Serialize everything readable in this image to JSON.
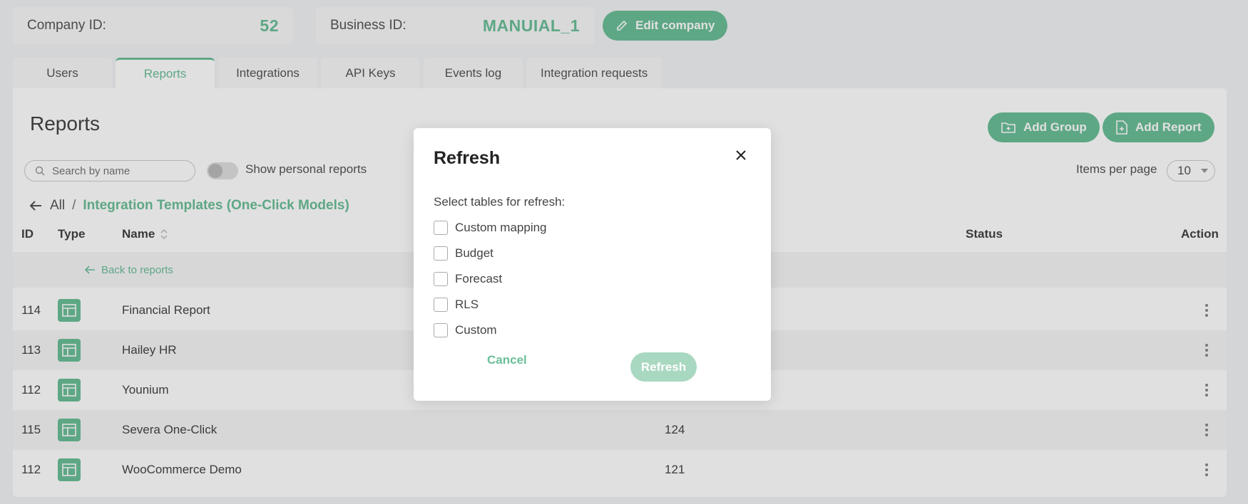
{
  "topbar": {
    "company_label": "Company ID:",
    "company_value": "52",
    "business_label": "Business ID:",
    "business_value": "MANUIAL_1",
    "edit_label": "Edit company"
  },
  "tabs": [
    {
      "label": "Users"
    },
    {
      "label": "Reports",
      "active": true
    },
    {
      "label": "Integrations"
    },
    {
      "label": "API Keys"
    },
    {
      "label": "Events log"
    },
    {
      "label": "Integration requests"
    }
  ],
  "panel": {
    "title": "Reports",
    "add_group": "Add Group",
    "add_report": "Add Report",
    "search_placeholder": "Search by name",
    "toggle_label": "Show personal reports",
    "ipp_label": "Items per page",
    "ipp_value": "10"
  },
  "breadcrumb": {
    "all": "All",
    "sep": "/",
    "current": "Integration Templates (One-Click Models)"
  },
  "table": {
    "headers": {
      "id": "ID",
      "type": "Type",
      "name": "Name",
      "status": "Status",
      "action": "Action"
    },
    "back_label": "Back to reports",
    "rows": [
      {
        "id": "114",
        "name": "Financial Report",
        "extra": ""
      },
      {
        "id": "113",
        "name": "Hailey HR",
        "extra": ""
      },
      {
        "id": "112",
        "name": "Younium",
        "extra": ""
      },
      {
        "id": "115",
        "name": "Severa One-Click",
        "extra": "124"
      },
      {
        "id": "112",
        "name": "WooCommerce Demo",
        "extra": "121"
      }
    ]
  },
  "modal": {
    "title": "Refresh",
    "subtitle": "Select tables for refresh:",
    "options": [
      "Custom mapping",
      "Budget",
      "Forecast",
      "RLS",
      "Custom"
    ],
    "cancel": "Cancel",
    "refresh": "Refresh"
  },
  "colors": {
    "accent": "#6bbf98",
    "accent_disabled": "#a9d8c0"
  }
}
